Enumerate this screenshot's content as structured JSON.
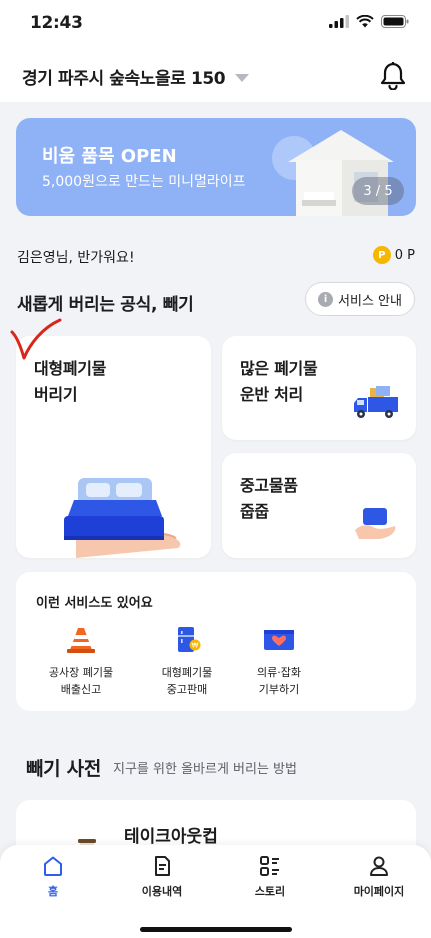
{
  "status": {
    "time": "12:43"
  },
  "header": {
    "address": "경기 파주시 숲속노을로 150"
  },
  "banner": {
    "title": "비움 품목 OPEN",
    "subtitle": "5,000원으로 만드는 미니멀라이프",
    "page_indicator": "3 / 5",
    "color": "#8fb1f5"
  },
  "greeting": {
    "text": "김은영님, 반가워요!",
    "coin_symbol": "P",
    "points": "0 P"
  },
  "section": {
    "title": "새롭게 버리는 공식, 빼기",
    "guide_label": "서비스 안내",
    "guide_icon": "i"
  },
  "cards": {
    "big_waste": "대형폐기물\n버리기",
    "bulk_move": "많은 폐기물\n운반 처리",
    "used_goods": "중고물품\n줍줍"
  },
  "other_services": {
    "title": "이런 서비스도 있어요",
    "items": [
      {
        "label": "공사장 폐기물\n배출신고",
        "icon": "traffic-cone-icon"
      },
      {
        "label": "대형폐기물\n중고판매",
        "icon": "fridge-icon"
      },
      {
        "label": "의류·잡화\n기부하기",
        "icon": "donation-box-icon"
      }
    ]
  },
  "dictionary": {
    "title": "빼기 사전",
    "subtitle": "지구를 위한 올바르게 버리는 방법",
    "card_title": "테이크아웃컵"
  },
  "tabs": [
    {
      "label": "홈",
      "active": true
    },
    {
      "label": "이용내역",
      "active": false
    },
    {
      "label": "스토리",
      "active": false
    },
    {
      "label": "마이페이지",
      "active": false
    }
  ],
  "colors": {
    "accent": "#2f5ee8",
    "background": "#f2f3f6",
    "annotation": "#d8261b"
  }
}
